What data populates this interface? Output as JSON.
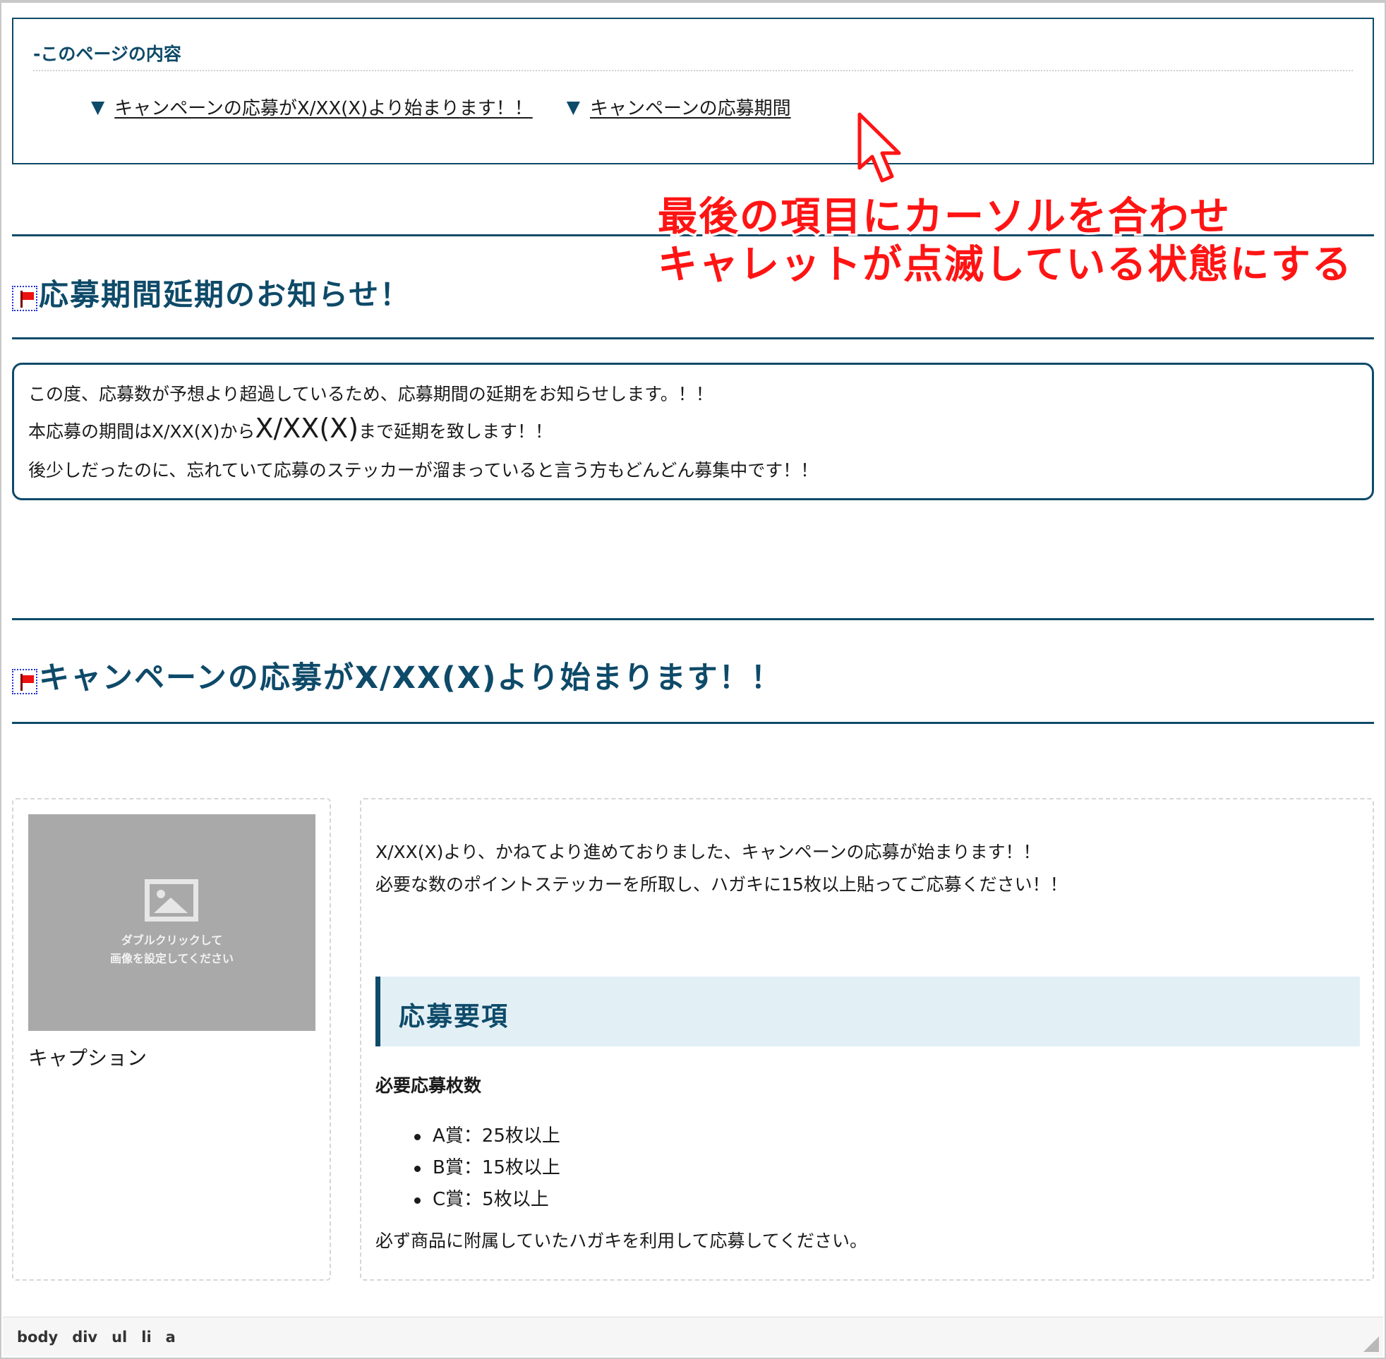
{
  "toc": {
    "title": "-このページの内容",
    "marker": "▼",
    "links": [
      "キャンペーンの応募がX/XX(X)より始まります！！",
      "キャンペーンの応募期間"
    ]
  },
  "annotation": {
    "line1": "最後の項目にカーソルを合わせ",
    "line2": "キャレットが点滅している状態にする"
  },
  "section1": {
    "heading": "応募期間延期のお知らせ！",
    "notice": {
      "line1": "この度、応募数が予想より超過しているため、応募期間の延期をお知らせします。！！",
      "line2_prefix": "本応募の期間はX/XX(X)から",
      "line2_big": "X/XX(X)",
      "line2_suffix": "まで延期を致します！！",
      "line3": "後少しだったのに、忘れていて応募のステッカーが溜まっていると言う方もどんどん募集中です！！"
    }
  },
  "section2": {
    "heading": "キャンペーンの応募がX/XX(X)より始まります！！",
    "image": {
      "placeholder_line1": "ダブルクリックして",
      "placeholder_line2": "画像を設定してください",
      "caption": "キャプション"
    },
    "intro_line1": "X/XX(X)より、かねてより進めておりました、キャンペーンの応募が始まります！！",
    "intro_line2": "必要な数のポイントステッカーを所取し、ハガキに15枚以上貼ってご応募ください！！",
    "subheading": "応募要項",
    "required_label": "必要応募枚数",
    "prizes": [
      "A賞：25枚以上",
      "B賞：15枚以上",
      "C賞：5枚以上"
    ],
    "note": "必ず商品に附属していたハガキを利用して応募してください。"
  },
  "statusbar": {
    "crumbs": [
      "body",
      "div",
      "ul",
      "li",
      "a"
    ]
  },
  "colors": {
    "accent": "#0e4a69",
    "annotation": "#ff1414",
    "subheading_bg": "#e2f0f6"
  },
  "icons": [
    "flag-icon",
    "image-placeholder-icon",
    "mouse-pointer-icon",
    "resize-grip-icon"
  ]
}
